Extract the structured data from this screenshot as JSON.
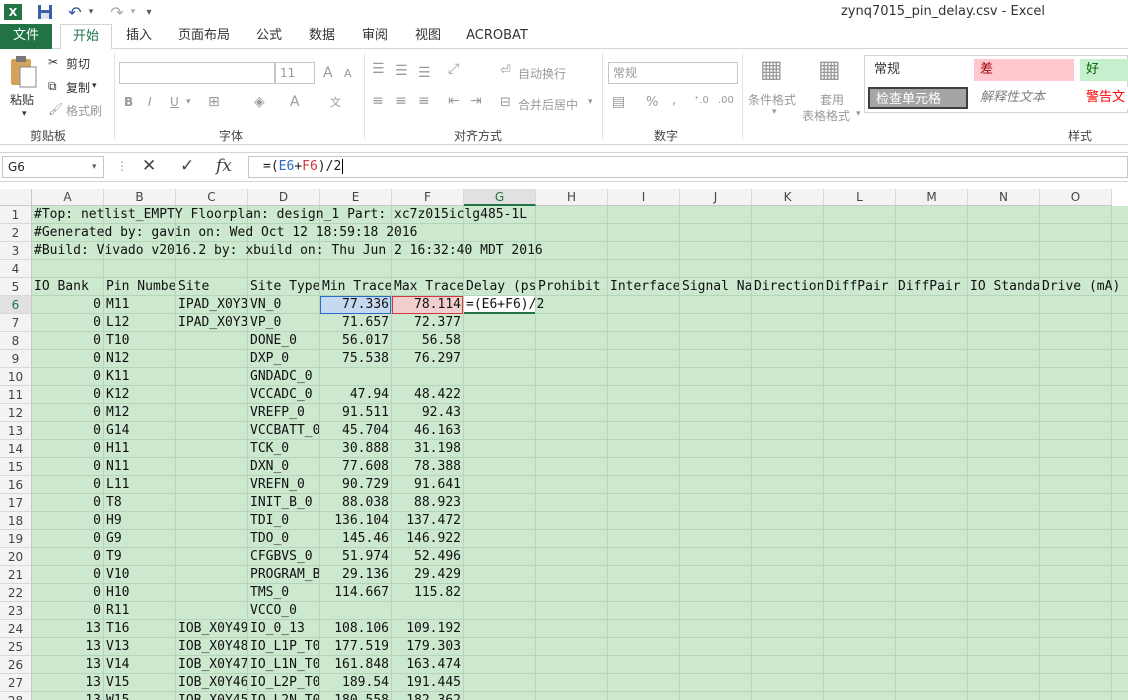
{
  "window": {
    "title": "zynq7015_pin_delay.csv - Excel"
  },
  "quick_access": {
    "more": "▾"
  },
  "tabs": [
    "文件",
    "开始",
    "插入",
    "页面布局",
    "公式",
    "数据",
    "审阅",
    "视图",
    "ACROBAT"
  ],
  "ribbon": {
    "clipboard": {
      "paste": "粘贴",
      "cut": "剪切",
      "copy": "复制",
      "format_painter": "格式刷",
      "label": "剪贴板"
    },
    "font": {
      "font_size": "11",
      "grow": "A",
      "shrink": "A",
      "bold": "B",
      "italic": "I",
      "underline": "U",
      "label": "字体"
    },
    "alignment": {
      "wrap": "自动换行",
      "merge": "合并后居中",
      "label": "对齐方式"
    },
    "number": {
      "format": "常规",
      "percent": "%",
      "comma": ",",
      "label": "数字"
    },
    "styles": {
      "conditional": "条件格式",
      "table_line1": "套用",
      "table_line2": "表格格式",
      "cells": [
        {
          "text": "常规",
          "bg": "#ffffff",
          "fg": "#333333"
        },
        {
          "text": "差",
          "bg": "#ffc7ce",
          "fg": "#9c0006"
        },
        {
          "text": "好",
          "bg": "#c6efce",
          "fg": "#006100"
        },
        {
          "text": "检查单元格",
          "bg": "#a5a5a5",
          "fg": "#ffffff"
        },
        {
          "text": "解释性文本",
          "bg": "#ffffff",
          "fg": "#7f7f7f"
        },
        {
          "text": "警告文",
          "bg": "#ffffff",
          "fg": "#ff0000"
        }
      ],
      "label": "样式"
    }
  },
  "formula_bar": {
    "name_box": "G6",
    "cancel": "✕",
    "enter": "✓",
    "fx": "fx",
    "formula": {
      "prefix": "=(",
      "ref1": "E6",
      "op": "+",
      "ref2": "F6",
      "suffix": ")/2"
    }
  },
  "columns": [
    "A",
    "B",
    "C",
    "D",
    "E",
    "F",
    "G",
    "H",
    "I",
    "J",
    "K",
    "L",
    "M",
    "N",
    "O"
  ],
  "rows": [
    {
      "n": "1",
      "A": "#Top: netlist_EMPTY   Floorplan: design_1   Part: xc7z015iclg485-1L"
    },
    {
      "n": "2",
      "A": "#Generated by: gavin   on: Wed Oct 12 18:59:18 2016"
    },
    {
      "n": "3",
      "A": "#Build: Vivado v2016.2   by: xbuild   on: Thu Jun  2 16:32:40 MDT 2016"
    },
    {
      "n": "4"
    },
    {
      "n": "5",
      "A": "IO Bank",
      "B": "Pin Number",
      "C": "Site",
      "D": "Site Type",
      "E": "Min Trace",
      "F": "Max Trace",
      "G": "Delay (ps)",
      "H": "Prohibit",
      "I": "Interface",
      "J": "Signal Name",
      "K": "Direction",
      "L": "DiffPair",
      "M": "DiffPair",
      "N": "IO Standard",
      "O": "Drive (mA)"
    },
    {
      "n": "6",
      "A": "0",
      "B": "M11",
      "C": "IPAD_X0Y3",
      "D": "VN_0",
      "E": "77.336",
      "F": "78.114",
      "G": "=(E6+F6)/2"
    },
    {
      "n": "7",
      "A": "0",
      "B": "L12",
      "C": "IPAD_X0Y3",
      "D": "VP_0",
      "E": "71.657",
      "F": "72.377"
    },
    {
      "n": "8",
      "A": "0",
      "B": "T10",
      "D": "DONE_0",
      "E": "56.017",
      "F": "56.58"
    },
    {
      "n": "9",
      "A": "0",
      "B": "N12",
      "D": "DXP_0",
      "E": "75.538",
      "F": "76.297"
    },
    {
      "n": "10",
      "A": "0",
      "B": "K11",
      "D": "GNDADC_0"
    },
    {
      "n": "11",
      "A": "0",
      "B": "K12",
      "D": "VCCADC_0",
      "E": "47.94",
      "F": "48.422"
    },
    {
      "n": "12",
      "A": "0",
      "B": "M12",
      "D": "VREFP_0",
      "E": "91.511",
      "F": "92.43"
    },
    {
      "n": "13",
      "A": "0",
      "B": "G14",
      "D": "VCCBATT_0",
      "E": "45.704",
      "F": "46.163"
    },
    {
      "n": "14",
      "A": "0",
      "B": "H11",
      "D": "TCK_0",
      "E": "30.888",
      "F": "31.198"
    },
    {
      "n": "15",
      "A": "0",
      "B": "N11",
      "D": "DXN_0",
      "E": "77.608",
      "F": "78.388"
    },
    {
      "n": "16",
      "A": "0",
      "B": "L11",
      "D": "VREFN_0",
      "E": "90.729",
      "F": "91.641"
    },
    {
      "n": "17",
      "A": "0",
      "B": "T8",
      "D": "INIT_B_0",
      "E": "88.038",
      "F": "88.923"
    },
    {
      "n": "18",
      "A": "0",
      "B": "H9",
      "D": "TDI_0",
      "E": "136.104",
      "F": "137.472"
    },
    {
      "n": "19",
      "A": "0",
      "B": "G9",
      "D": "TDO_0",
      "E": "145.46",
      "F": "146.922"
    },
    {
      "n": "20",
      "A": "0",
      "B": "T9",
      "D": "CFGBVS_0",
      "E": "51.974",
      "F": "52.496"
    },
    {
      "n": "21",
      "A": "0",
      "B": "V10",
      "D": "PROGRAM_B",
      "E": "29.136",
      "F": "29.429"
    },
    {
      "n": "22",
      "A": "0",
      "B": "H10",
      "D": "TMS_0",
      "E": "114.667",
      "F": "115.82"
    },
    {
      "n": "23",
      "A": "0",
      "B": "R11",
      "D": "VCCO_0"
    },
    {
      "n": "24",
      "A": "13",
      "B": "T16",
      "C": "IOB_X0Y49",
      "D": "IO_0_13",
      "E": "108.106",
      "F": "109.192"
    },
    {
      "n": "25",
      "A": "13",
      "B": "V13",
      "C": "IOB_X0Y48",
      "D": "IO_L1P_T0",
      "E": "177.519",
      "F": "179.303"
    },
    {
      "n": "26",
      "A": "13",
      "B": "V14",
      "C": "IOB_X0Y47",
      "D": "IO_L1N_T0",
      "E": "161.848",
      "F": "163.474"
    },
    {
      "n": "27",
      "A": "13",
      "B": "V15",
      "C": "IOB_X0Y46",
      "D": "IO_L2P_T0",
      "E": "189.54",
      "F": "191.445"
    },
    {
      "n": "28",
      "A": "13",
      "B": "W15",
      "C": "IOB_X0Y45",
      "D": "IO_L2N_T0",
      "E": "180.558",
      "F": "182.362"
    }
  ]
}
